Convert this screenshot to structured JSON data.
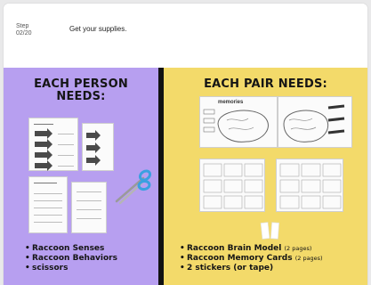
{
  "step": {
    "label": "Step",
    "number": "02/20",
    "title": "Get your supplies."
  },
  "left_panel": {
    "heading": "EACH PERSON NEEDS:",
    "items": [
      {
        "text": "Raccoon Senses"
      },
      {
        "text": "Raccoon Behaviors"
      },
      {
        "text": "scissors"
      }
    ],
    "background": "#b79ff0"
  },
  "right_panel": {
    "heading": "EACH PAIR NEEDS:",
    "items": [
      {
        "text": "Raccoon Brain Model",
        "note": "(2 pages)"
      },
      {
        "text": "Raccoon Memory Cards",
        "note": "(2 pages)"
      },
      {
        "text": "2 stickers (or tape)",
        "note": ""
      }
    ],
    "worksheet_title": "memories",
    "background": "#f3da6a"
  },
  "colors": {
    "divider": "#121212",
    "scissors_handle": "#3aa0e0"
  },
  "icons": {
    "scissors": "scissors-icon",
    "stickers": "sticker-icon",
    "bullet": "•"
  }
}
